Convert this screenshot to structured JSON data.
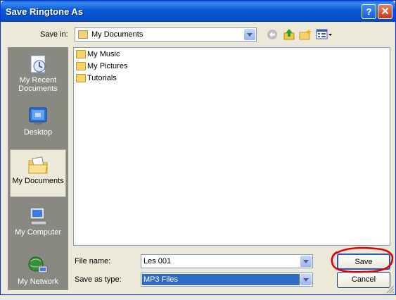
{
  "window": {
    "title": "Save Ringtone As"
  },
  "titlebar_buttons": {
    "help": "?",
    "close": "✕"
  },
  "save_in": {
    "label": "Save in:",
    "value": "My Documents"
  },
  "toolbar_icons": [
    "back-icon",
    "up-folder-icon",
    "new-folder-icon",
    "views-menu-icon"
  ],
  "places": [
    {
      "label_line1": "My Recent",
      "label_line2": "Documents"
    },
    {
      "label_line1": "Desktop",
      "label_line2": ""
    },
    {
      "label_line1": "My Documents",
      "label_line2": ""
    },
    {
      "label_line1": "My Computer",
      "label_line2": ""
    },
    {
      "label_line1": "My Network",
      "label_line2": ""
    }
  ],
  "files": [
    {
      "name": "My Music",
      "icon": "music-folder-icon"
    },
    {
      "name": "My Pictures",
      "icon": "pictures-folder-icon"
    },
    {
      "name": "Tutorials",
      "icon": "folder-icon"
    }
  ],
  "file_name": {
    "label": "File name:",
    "value": "Les 001"
  },
  "save_as_type": {
    "label": "Save as type:",
    "value": "MP3 Files"
  },
  "buttons": {
    "save": "Save",
    "cancel": "Cancel"
  },
  "colors": {
    "title_bar": "#0a58d6",
    "highlight": "#316ac5",
    "annotation_circle": "#e00000"
  }
}
